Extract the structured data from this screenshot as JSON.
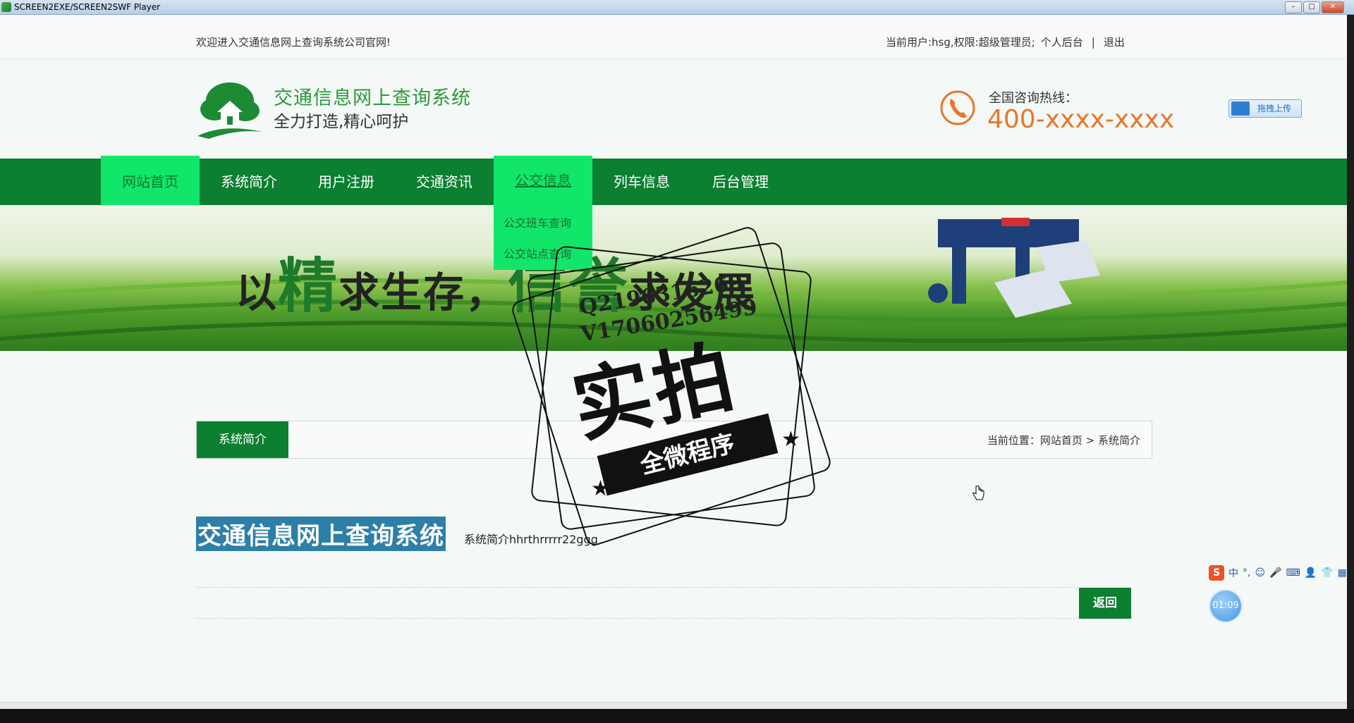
{
  "window": {
    "title": "SCREEN2EXE/SCREEN2SWF Player",
    "controls": {
      "minimize": "–",
      "maximize": "□",
      "close": "✕"
    }
  },
  "topbar": {
    "welcome": "欢迎进入交通信息网上查询系统公司官网!",
    "user_info": "当前用户:hsg,权限:超级管理员;",
    "personal_link": "个人后台",
    "separator": "|",
    "logout": "退出"
  },
  "header": {
    "title": "交通信息网上查询系统",
    "slogan": "全力打造,精心呵护",
    "hotline_label": "全国咨询热线：",
    "hotline_number": "400-xxxx-xxxx",
    "upload_label": "拖拽上传"
  },
  "nav": {
    "items": [
      {
        "label": "网站首页"
      },
      {
        "label": "系统简介"
      },
      {
        "label": "用户注册"
      },
      {
        "label": "交通资讯"
      },
      {
        "label": "公交信息"
      },
      {
        "label": "列车信息"
      },
      {
        "label": "后台管理"
      }
    ],
    "dropdown": [
      {
        "label": "公交班车查询"
      },
      {
        "label": "公交站点查询"
      }
    ]
  },
  "banner": {
    "slogan_part1": "以",
    "slogan_big1": "精",
    "slogan_part2": "求生存，",
    "slogan_big2": "信誉",
    "slogan_part3": "求发展"
  },
  "content": {
    "section_tab": "系统简介",
    "breadcrumb_prefix": "当前位置：",
    "breadcrumb_home": "网站首页",
    "breadcrumb_sep": ">",
    "breadcrumb_current": "系统简介",
    "article_title": "交通信息网上查询系统",
    "article_body": "系统简介hhrthrrrrr22ggg",
    "back_button": "返回"
  },
  "watermark": {
    "qq": "Q2196316269",
    "vx": "V17060256499",
    "main": "实拍",
    "ribbon": "全微程序"
  },
  "overlay": {
    "ime_logo": "S",
    "ime_mode": "中",
    "ime_punct": "°,",
    "timer": "01:09"
  },
  "colors": {
    "nav_green": "#0c7f31",
    "highlight_green": "#12e66a",
    "title_green": "#2d9a3b",
    "hotline_orange": "#e8762b",
    "selection_blue": "#2d7fa8"
  }
}
